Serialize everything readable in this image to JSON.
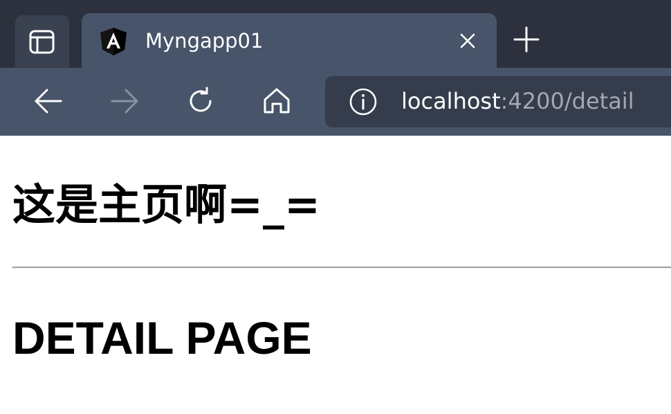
{
  "browser": {
    "tabs": [
      {
        "title": "Myngapp01",
        "favicon": "angular-logo-icon",
        "active": true
      }
    ],
    "tab_actions_icon": "tab-actions-icon",
    "new_tab_icon": "plus-icon",
    "close_icon": "close-icon",
    "toolbar": {
      "back_icon": "arrow-left-icon",
      "forward_icon": "arrow-right-icon",
      "forward_enabled": false,
      "reload_icon": "refresh-icon",
      "home_icon": "home-icon"
    },
    "address_bar": {
      "site_info_icon": "info-icon",
      "url_host": "localhost",
      "url_rest": ":4200/detail"
    },
    "colors": {
      "tabstrip_bg": "#2c313d",
      "active_tab_bg": "#475469",
      "address_bar_bg": "#353c4b",
      "url_dim_text": "#a3a8b4"
    }
  },
  "page": {
    "heading": "这是主页啊=_=",
    "detail_heading": "DETAIL PAGE"
  }
}
